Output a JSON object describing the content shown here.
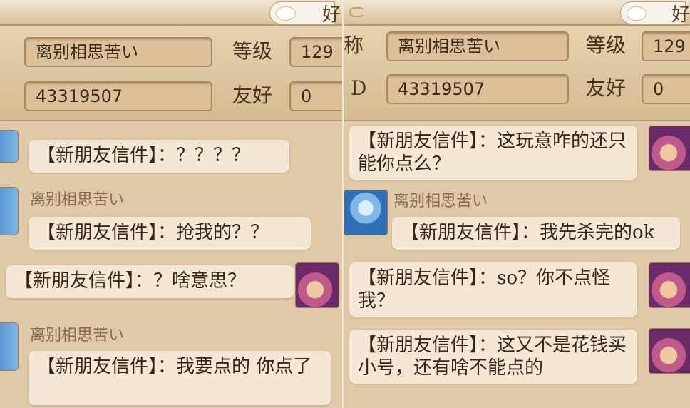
{
  "left_panel": {
    "title_fragment": "好",
    "nickname_value": "离别相思苦い",
    "id_value": "43319507",
    "level_label": "等级",
    "level_value": "129",
    "friendly_label": "友好",
    "friendly_value": "0",
    "messages": [
      {
        "text": "【新朋友信件】：？？？？"
      },
      {
        "sender": "离别相思苦い",
        "text": "【新朋友信件】：抢我的？？"
      },
      {
        "text": "【新朋友信件】：？啥意思？"
      },
      {
        "sender": "离别相思苦い",
        "text": "【新朋友信件】：我要点的  你点了"
      }
    ]
  },
  "right_panel": {
    "title_fragment": "好",
    "nickname_label_fragment": "称",
    "id_label_fragment": "D",
    "nickname_value": "离别相思苦い",
    "id_value": "43319507",
    "level_label": "等级",
    "level_value": "129",
    "friendly_label": "友好",
    "friendly_value": "0",
    "messages": [
      {
        "text": "【新朋友信件】：这玩意咋的还只能你点么？"
      },
      {
        "sender": "离别相思苦い",
        "text": "【新朋友信件】：我先杀完的ok"
      },
      {
        "text": "【新朋友信件】：so？你不点怪我？"
      },
      {
        "text": "【新朋友信件】：这又不是花钱买小号，还有啥不能点的"
      }
    ]
  },
  "icons": {
    "player_avatar": "blue-haired-character",
    "friend_avatar": "red-haired-character",
    "cloud_tab": "cloud-icon"
  }
}
